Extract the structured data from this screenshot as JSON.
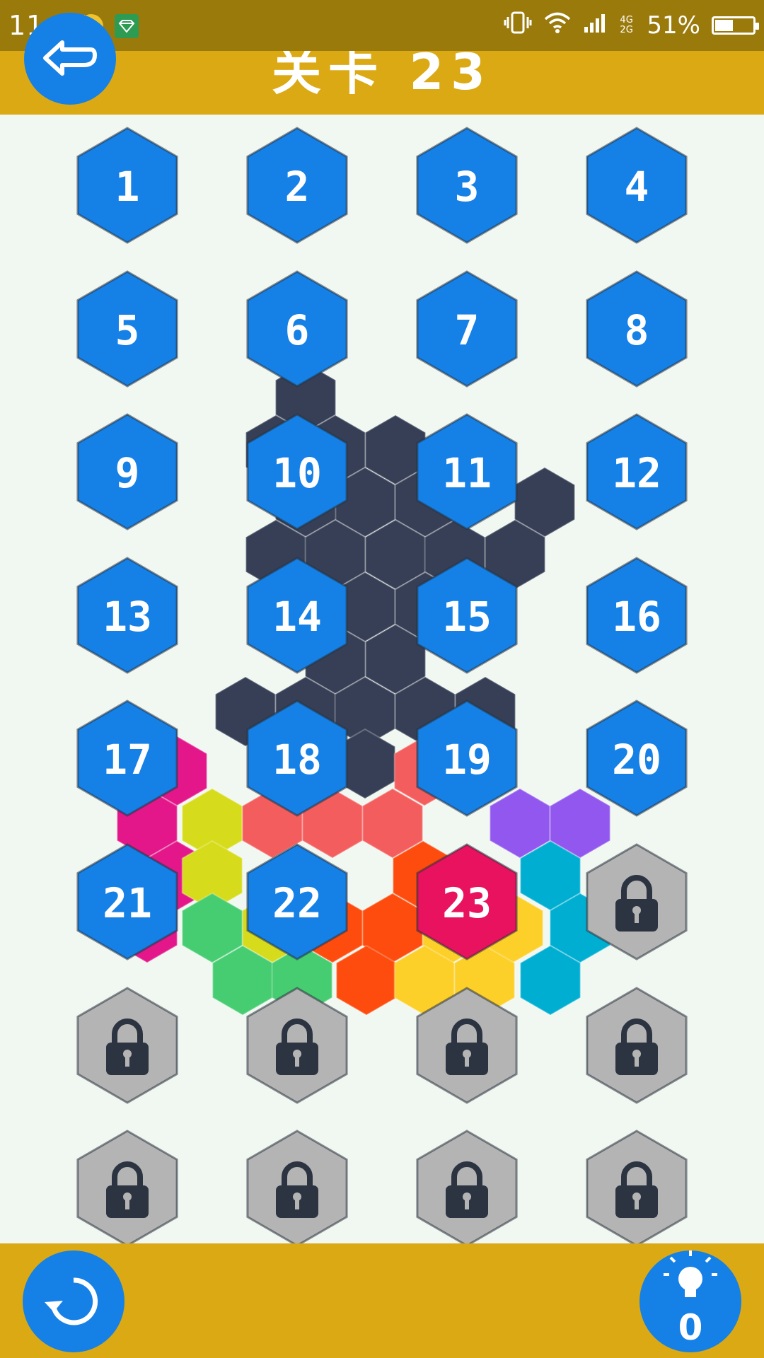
{
  "status_bar": {
    "time": "11:25",
    "network": "4G 2G",
    "battery_percent": "51%",
    "battery_level": 0.51
  },
  "header": {
    "title": "关卡 23",
    "back_icon": "back-arrow-icon"
  },
  "levels": [
    {
      "label": "1",
      "state": "completed"
    },
    {
      "label": "2",
      "state": "completed"
    },
    {
      "label": "3",
      "state": "completed"
    },
    {
      "label": "4",
      "state": "completed"
    },
    {
      "label": "5",
      "state": "completed"
    },
    {
      "label": "6",
      "state": "completed"
    },
    {
      "label": "7",
      "state": "completed"
    },
    {
      "label": "8",
      "state": "completed"
    },
    {
      "label": "9",
      "state": "completed"
    },
    {
      "label": "10",
      "state": "completed"
    },
    {
      "label": "11",
      "state": "completed"
    },
    {
      "label": "12",
      "state": "completed"
    },
    {
      "label": "13",
      "state": "completed"
    },
    {
      "label": "14",
      "state": "completed"
    },
    {
      "label": "15",
      "state": "completed"
    },
    {
      "label": "16",
      "state": "completed"
    },
    {
      "label": "17",
      "state": "completed"
    },
    {
      "label": "18",
      "state": "completed"
    },
    {
      "label": "19",
      "state": "completed"
    },
    {
      "label": "20",
      "state": "completed"
    },
    {
      "label": "21",
      "state": "completed"
    },
    {
      "label": "22",
      "state": "completed"
    },
    {
      "label": "23",
      "state": "current"
    },
    {
      "label": "",
      "state": "locked"
    },
    {
      "label": "",
      "state": "locked"
    },
    {
      "label": "",
      "state": "locked"
    },
    {
      "label": "",
      "state": "locked"
    },
    {
      "label": "",
      "state": "locked"
    },
    {
      "label": "",
      "state": "locked"
    },
    {
      "label": "",
      "state": "locked"
    },
    {
      "label": "",
      "state": "locked"
    },
    {
      "label": "",
      "state": "locked"
    }
  ],
  "colors": {
    "completed": "#1580e6",
    "current": "#e8125f",
    "locked": "#b4b4b4",
    "lock_icon": "#2b3440",
    "header": "#dba913",
    "status_bar": "#9b7a0c",
    "background": "#f1f7f1",
    "puzzle_dark": "#363f55",
    "puzzle_magenta": "#e3178a",
    "puzzle_yellow_green": "#d6dc1b",
    "puzzle_salmon": "#f45d5d",
    "puzzle_orange": "#fd4c0d",
    "puzzle_yellow": "#fdcf29",
    "puzzle_purple": "#9157ee",
    "puzzle_cyan": "#00aed2",
    "puzzle_green": "#46cc71"
  },
  "footer": {
    "restart_icon": "restart-icon",
    "hint_icon": "lightbulb-icon",
    "hint_count": "0"
  }
}
